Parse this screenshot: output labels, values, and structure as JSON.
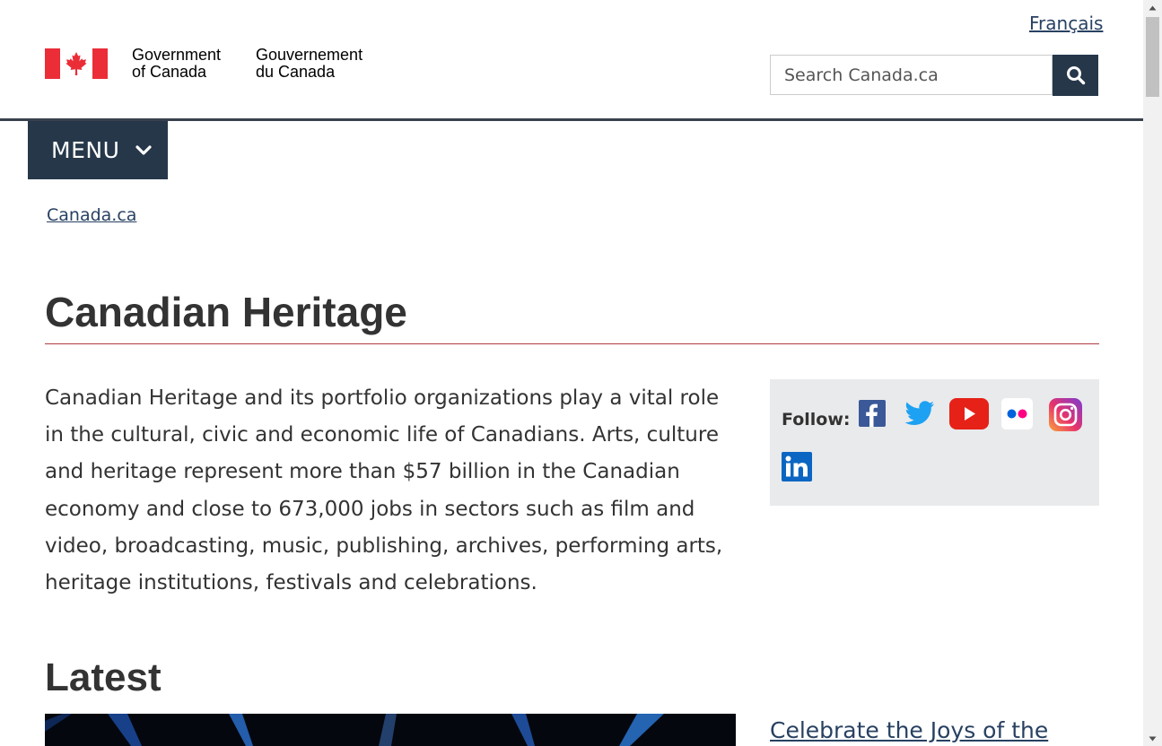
{
  "header": {
    "language_link": "Français",
    "signature_en_line1": "Government",
    "signature_en_line2": "of Canada",
    "signature_fr_line1": "Gouvernement",
    "signature_fr_line2": "du Canada",
    "search_placeholder": "Search Canada.ca",
    "menu_label": "MENU"
  },
  "breadcrumb": {
    "items": [
      {
        "label": "Canada.ca"
      }
    ]
  },
  "main": {
    "title": "Canadian Heritage",
    "intro": "Canadian Heritage and its portfolio organizations play a vital role in the cultural, civic and economic life of Canadians. Arts, culture and heritage represent more than $57 billion in the Canadian economy and close to 673,000 jobs in sectors such as film and video, broadcasting, music, publishing, archives, performing arts, heritage institutions, festivals and celebrations.",
    "follow": {
      "label": "Follow:",
      "networks": [
        "facebook-icon",
        "twitter-icon",
        "youtube-icon",
        "flickr-icon",
        "instagram-icon",
        "linkedin-icon"
      ]
    },
    "latest": {
      "title": "Latest",
      "feature_link": "Celebrate the Joys of the"
    }
  },
  "colors": {
    "brand_dark": "#26374a",
    "link": "#284162",
    "title_rule": "#af3c43",
    "flag_red": "#eb2d37",
    "follow_bg": "#e9eaec"
  }
}
